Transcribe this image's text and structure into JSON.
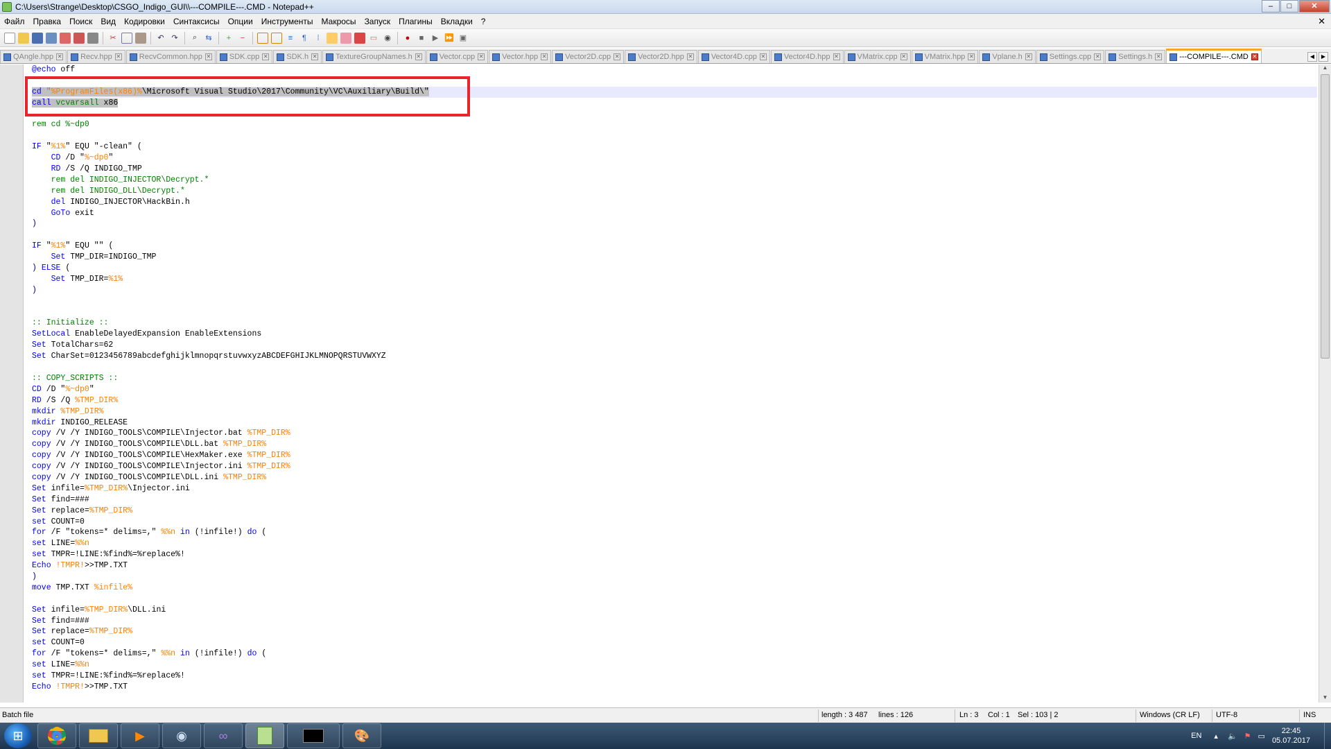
{
  "window": {
    "title": "C:\\Users\\Strange\\Desktop\\CSGO_Indigo_GUI\\\\---COMPILE---.CMD - Notepad++",
    "min": "–",
    "max": "□",
    "close": "✕"
  },
  "menu": [
    "Файл",
    "Правка",
    "Поиск",
    "Вид",
    "Кодировки",
    "Синтаксисы",
    "Опции",
    "Инструменты",
    "Макросы",
    "Запуск",
    "Плагины",
    "Вкладки",
    "?"
  ],
  "menu_close": "✕",
  "tabs": [
    "QAngle.hpp",
    "Recv.hpp",
    "RecvCommon.hpp",
    "SDK.cpp",
    "SDK.h",
    "TextureGroupNames.h",
    "Vector.cpp",
    "Vector.hpp",
    "Vector2D.cpp",
    "Vector2D.hpp",
    "Vector4D.cpp",
    "Vector4D.hpp",
    "VMatrix.cpp",
    "VMatrix.hpp",
    "Vplane.h",
    "Settings.cpp",
    "Settings.h",
    "---COMPILE---.CMD"
  ],
  "active_tab": "---COMPILE---.CMD",
  "code_lines": [
    [
      [
        "kw",
        "@echo"
      ],
      [
        "t",
        " off"
      ]
    ],
    [],
    [
      [
        "kw",
        "cd"
      ],
      [
        "t",
        " "
      ],
      [
        "str",
        "\""
      ],
      [
        "var",
        "%ProgramFiles(x86)%"
      ],
      [
        "t",
        "\\Microsoft Visual Studio\\2017\\Community\\VC\\Auxiliary\\Build\\\""
      ]
    ],
    [
      [
        "kw",
        "call"
      ],
      [
        "t",
        " "
      ],
      [
        "cmt",
        "vcvarsall"
      ],
      [
        "t",
        " x86"
      ]
    ],
    [],
    [
      [
        "cmt",
        "rem cd %~dp0"
      ]
    ],
    [],
    [
      [
        "kw",
        "IF"
      ],
      [
        "t",
        " \""
      ],
      [
        "var",
        "%1%"
      ],
      [
        "t",
        "\" EQU \"-clean\" ("
      ]
    ],
    [
      [
        "t",
        "    "
      ],
      [
        "kw",
        "CD"
      ],
      [
        "t",
        " /D \""
      ],
      [
        "var",
        "%~dp0"
      ],
      [
        "t",
        "\""
      ]
    ],
    [
      [
        "t",
        "    "
      ],
      [
        "kw",
        "RD"
      ],
      [
        "t",
        " /S /Q INDIGO_TMP"
      ]
    ],
    [
      [
        "t",
        "    "
      ],
      [
        "cmt",
        "rem del INDIGO_INJECTOR\\Decrypt.*"
      ]
    ],
    [
      [
        "t",
        "    "
      ],
      [
        "cmt",
        "rem del INDIGO_DLL\\Decrypt.*"
      ]
    ],
    [
      [
        "t",
        "    "
      ],
      [
        "kw",
        "del"
      ],
      [
        "t",
        " INDIGO_INJECTOR\\HackBin.h"
      ]
    ],
    [
      [
        "t",
        "    "
      ],
      [
        "kw",
        "GoTo"
      ],
      [
        "t",
        " exit"
      ]
    ],
    [
      [
        "op",
        ")"
      ]
    ],
    [],
    [
      [
        "kw",
        "IF"
      ],
      [
        "t",
        " \""
      ],
      [
        "var",
        "%1%"
      ],
      [
        "t",
        "\" EQU \"\" ("
      ]
    ],
    [
      [
        "t",
        "    "
      ],
      [
        "kw",
        "Set"
      ],
      [
        "t",
        " TMP_DIR=INDIGO_TMP"
      ]
    ],
    [
      [
        "op",
        ")"
      ],
      [
        "t",
        " "
      ],
      [
        "kw",
        "ELSE"
      ],
      [
        "t",
        " ("
      ]
    ],
    [
      [
        "t",
        "    "
      ],
      [
        "kw",
        "Set"
      ],
      [
        "t",
        " TMP_DIR="
      ],
      [
        "var",
        "%1%"
      ]
    ],
    [
      [
        "op",
        ")"
      ]
    ],
    [],
    [],
    [
      [
        "cmt",
        ":: Initialize ::"
      ]
    ],
    [
      [
        "kw",
        "SetLocal"
      ],
      [
        "t",
        " EnableDelayedExpansion EnableExtensions"
      ]
    ],
    [
      [
        "kw",
        "Set"
      ],
      [
        "t",
        " TotalChars=62"
      ]
    ],
    [
      [
        "kw",
        "Set"
      ],
      [
        "t",
        " CharSet=0123456789abcdefghijklmnopqrstuvwxyzABCDEFGHIJKLMNOPQRSTUVWXYZ"
      ]
    ],
    [],
    [
      [
        "cmt",
        ":: COPY_SCRIPTS ::"
      ]
    ],
    [
      [
        "kw",
        "CD"
      ],
      [
        "t",
        " /D \""
      ],
      [
        "var",
        "%~dp0"
      ],
      [
        "t",
        "\""
      ]
    ],
    [
      [
        "kw",
        "RD"
      ],
      [
        "t",
        " /S /Q "
      ],
      [
        "var",
        "%TMP_DIR%"
      ]
    ],
    [
      [
        "kw",
        "mkdir"
      ],
      [
        "t",
        " "
      ],
      [
        "var",
        "%TMP_DIR%"
      ]
    ],
    [
      [
        "kw",
        "mkdir"
      ],
      [
        "t",
        " INDIGO_RELEASE"
      ]
    ],
    [
      [
        "kw",
        "copy"
      ],
      [
        "t",
        " /V /Y INDIGO_TOOLS\\COMPILE\\Injector.bat "
      ],
      [
        "var",
        "%TMP_DIR%"
      ]
    ],
    [
      [
        "kw",
        "copy"
      ],
      [
        "t",
        " /V /Y INDIGO_TOOLS\\COMPILE\\DLL.bat "
      ],
      [
        "var",
        "%TMP_DIR%"
      ]
    ],
    [
      [
        "kw",
        "copy"
      ],
      [
        "t",
        " /V /Y INDIGO_TOOLS\\COMPILE\\HexMaker.exe "
      ],
      [
        "var",
        "%TMP_DIR%"
      ]
    ],
    [
      [
        "kw",
        "copy"
      ],
      [
        "t",
        " /V /Y INDIGO_TOOLS\\COMPILE\\Injector.ini "
      ],
      [
        "var",
        "%TMP_DIR%"
      ]
    ],
    [
      [
        "kw",
        "copy"
      ],
      [
        "t",
        " /V /Y INDIGO_TOOLS\\COMPILE\\DLL.ini "
      ],
      [
        "var",
        "%TMP_DIR%"
      ]
    ],
    [
      [
        "kw",
        "Set"
      ],
      [
        "t",
        " infile="
      ],
      [
        "var",
        "%TMP_DIR%"
      ],
      [
        "t",
        "\\Injector.ini"
      ]
    ],
    [
      [
        "kw",
        "Set"
      ],
      [
        "t",
        " find=###"
      ]
    ],
    [
      [
        "kw",
        "Set"
      ],
      [
        "t",
        " replace="
      ],
      [
        "var",
        "%TMP_DIR%"
      ]
    ],
    [
      [
        "kw",
        "set"
      ],
      [
        "t",
        " COUNT=0"
      ]
    ],
    [
      [
        "kw",
        "for"
      ],
      [
        "t",
        " /F \"tokens=* delims=,\" "
      ],
      [
        "var",
        "%%n"
      ],
      [
        "t",
        " "
      ],
      [
        "kw",
        "in"
      ],
      [
        "t",
        " (!infile!) "
      ],
      [
        "kw",
        "do"
      ],
      [
        "t",
        " ("
      ]
    ],
    [
      [
        "kw",
        "set"
      ],
      [
        "t",
        " LINE="
      ],
      [
        "var",
        "%%n"
      ]
    ],
    [
      [
        "kw",
        "set"
      ],
      [
        "t",
        " TMPR=!LINE:%find%=%replace%!"
      ]
    ],
    [
      [
        "kw",
        "Echo"
      ],
      [
        "t",
        " "
      ],
      [
        "var",
        "!TMPR!"
      ],
      [
        "t",
        ">>TMP.TXT"
      ]
    ],
    [
      [
        "op",
        ")"
      ]
    ],
    [
      [
        "kw",
        "move"
      ],
      [
        "t",
        " TMP.TXT "
      ],
      [
        "var",
        "%infile%"
      ]
    ],
    [],
    [
      [
        "kw",
        "Set"
      ],
      [
        "t",
        " infile="
      ],
      [
        "var",
        "%TMP_DIR%"
      ],
      [
        "t",
        "\\DLL.ini"
      ]
    ],
    [
      [
        "kw",
        "Set"
      ],
      [
        "t",
        " find=###"
      ]
    ],
    [
      [
        "kw",
        "Set"
      ],
      [
        "t",
        " replace="
      ],
      [
        "var",
        "%TMP_DIR%"
      ]
    ],
    [
      [
        "kw",
        "set"
      ],
      [
        "t",
        " COUNT=0"
      ]
    ],
    [
      [
        "kw",
        "for"
      ],
      [
        "t",
        " /F \"tokens=* delims=,\" "
      ],
      [
        "var",
        "%%n"
      ],
      [
        "t",
        " "
      ],
      [
        "kw",
        "in"
      ],
      [
        "t",
        " (!infile!) "
      ],
      [
        "kw",
        "do"
      ],
      [
        "t",
        " ("
      ]
    ],
    [
      [
        "kw",
        "set"
      ],
      [
        "t",
        " LINE="
      ],
      [
        "var",
        "%%n"
      ]
    ],
    [
      [
        "kw",
        "set"
      ],
      [
        "t",
        " TMPR=!LINE:%find%=%replace%!"
      ]
    ],
    [
      [
        "kw",
        "Echo"
      ],
      [
        "t",
        " "
      ],
      [
        "var",
        "!TMPR!"
      ],
      [
        "t",
        ">>TMP.TXT"
      ]
    ]
  ],
  "current_line": 3,
  "selected_lines": [
    3,
    4
  ],
  "status": {
    "filetype": "Batch file",
    "length": "length : 3 487",
    "lines": "lines : 126",
    "ln": "Ln : 3",
    "col": "Col : 1",
    "sel": "Sel : 103 | 2",
    "eol": "Windows (CR LF)",
    "enc": "UTF-8",
    "mode": "INS"
  },
  "taskbar": {
    "apps": [
      "chrome-icon",
      "explorer-icon",
      "media-player-icon",
      "steam-icon",
      "visual-studio-icon",
      "notepadpp-icon",
      "cmd-icon",
      "paint-icon"
    ],
    "lang": "EN",
    "time": "22:45",
    "date": "05.07.2017"
  },
  "colors": {
    "keyword": "#0000ff",
    "variable": "#ff8000",
    "comment": "#008000",
    "highlight_box": "#e8242c"
  }
}
